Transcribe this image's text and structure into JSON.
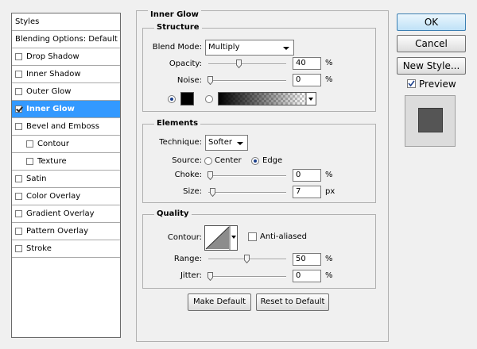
{
  "styles_list": {
    "header": "Styles",
    "blending": "Blending Options: Default",
    "items": [
      {
        "label": "Drop Shadow",
        "checked": false,
        "indent": false,
        "selected": false
      },
      {
        "label": "Inner Shadow",
        "checked": false,
        "indent": false,
        "selected": false
      },
      {
        "label": "Outer Glow",
        "checked": false,
        "indent": false,
        "selected": false
      },
      {
        "label": "Inner Glow",
        "checked": true,
        "indent": false,
        "selected": true
      },
      {
        "label": "Bevel and Emboss",
        "checked": false,
        "indent": false,
        "selected": false
      },
      {
        "label": "Contour",
        "checked": false,
        "indent": true,
        "selected": false
      },
      {
        "label": "Texture",
        "checked": false,
        "indent": true,
        "selected": false
      },
      {
        "label": "Satin",
        "checked": false,
        "indent": false,
        "selected": false
      },
      {
        "label": "Color Overlay",
        "checked": false,
        "indent": false,
        "selected": false
      },
      {
        "label": "Gradient Overlay",
        "checked": false,
        "indent": false,
        "selected": false
      },
      {
        "label": "Pattern Overlay",
        "checked": false,
        "indent": false,
        "selected": false
      },
      {
        "label": "Stroke",
        "checked": false,
        "indent": false,
        "selected": false
      }
    ]
  },
  "panel": {
    "title": "Inner Glow",
    "structure": {
      "title": "Structure",
      "blend_mode_label": "Blend Mode:",
      "blend_mode_value": "Multiply",
      "opacity_label": "Opacity:",
      "opacity_value": "40",
      "opacity_fraction": 0.4,
      "noise_label": "Noise:",
      "noise_value": "0",
      "noise_fraction": 0,
      "percent": "%",
      "glow_color": "#000000"
    },
    "elements": {
      "title": "Elements",
      "technique_label": "Technique:",
      "technique_value": "Softer",
      "source_label": "Source:",
      "source_center": "Center",
      "source_edge": "Edge",
      "choke_label": "Choke:",
      "choke_value": "0",
      "choke_fraction": 0,
      "size_label": "Size:",
      "size_value": "7",
      "size_fraction": 0.03,
      "percent": "%",
      "px": "px"
    },
    "quality": {
      "title": "Quality",
      "contour_label": "Contour:",
      "anti_aliased_label": "Anti-aliased",
      "range_label": "Range:",
      "range_value": "50",
      "range_fraction": 0.5,
      "jitter_label": "Jitter:",
      "jitter_value": "0",
      "jitter_fraction": 0,
      "percent": "%"
    },
    "make_default": "Make Default",
    "reset_default": "Reset to Default"
  },
  "buttons": {
    "ok": "OK",
    "cancel": "Cancel",
    "new_style": "New Style...",
    "preview_label": "Preview",
    "preview_checked": true
  },
  "colors": {
    "selection": "#3399ff",
    "preview_swatch": "#555555",
    "preview_bg": "#dcdcdc"
  }
}
